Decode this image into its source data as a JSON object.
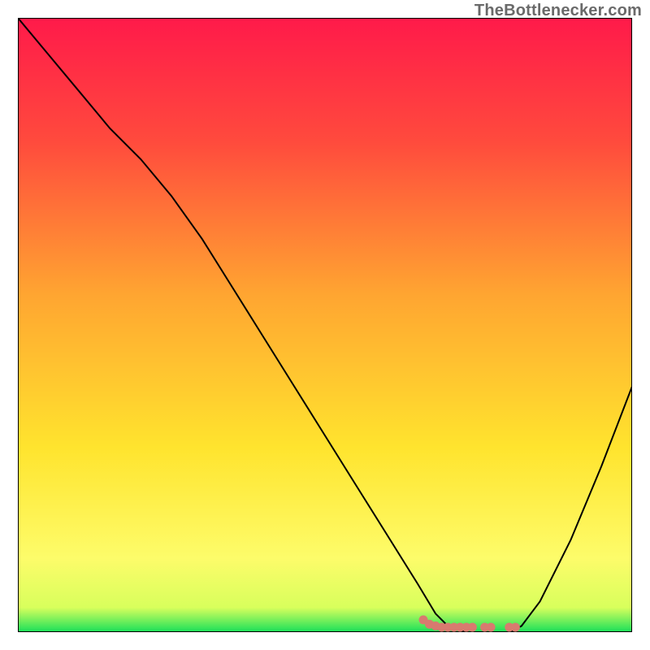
{
  "attribution": "TheBottlenecker.com",
  "chart_data": {
    "type": "line",
    "title": "",
    "xlabel": "",
    "ylabel": "",
    "xlim": [
      0,
      100
    ],
    "ylim": [
      0,
      100
    ],
    "grid": false,
    "legend": false,
    "series": [
      {
        "name": "curve",
        "x": [
          0,
          5,
          10,
          15,
          20,
          25,
          30,
          35,
          40,
          45,
          50,
          55,
          60,
          65,
          68,
          70,
          73,
          76,
          80,
          82,
          85,
          90,
          95,
          100
        ],
        "y": [
          100,
          94,
          88,
          82,
          77,
          71,
          64,
          56,
          48,
          40,
          32,
          24,
          16,
          8,
          3,
          1,
          0,
          0,
          0,
          1,
          5,
          15,
          27,
          40
        ],
        "color": "#000000",
        "width": 2
      }
    ],
    "bottom_band": {
      "name": "optimal-zone-dots",
      "color": "#d87a6f",
      "x": [
        66,
        67,
        68,
        69,
        70,
        71,
        72,
        73,
        74,
        76,
        77,
        80,
        81
      ],
      "y": [
        2.0,
        1.3,
        1.0,
        0.8,
        0.8,
        0.8,
        0.8,
        0.8,
        0.8,
        0.8,
        0.8,
        0.8,
        0.8
      ]
    },
    "background_gradient": {
      "stops": [
        {
          "offset": 0.0,
          "color": "#ff1a4a"
        },
        {
          "offset": 0.2,
          "color": "#ff4a3d"
        },
        {
          "offset": 0.45,
          "color": "#ffa531"
        },
        {
          "offset": 0.7,
          "color": "#ffe42e"
        },
        {
          "offset": 0.88,
          "color": "#fdfc6a"
        },
        {
          "offset": 0.96,
          "color": "#d8ff5c"
        },
        {
          "offset": 1.0,
          "color": "#18e05a"
        }
      ]
    }
  }
}
